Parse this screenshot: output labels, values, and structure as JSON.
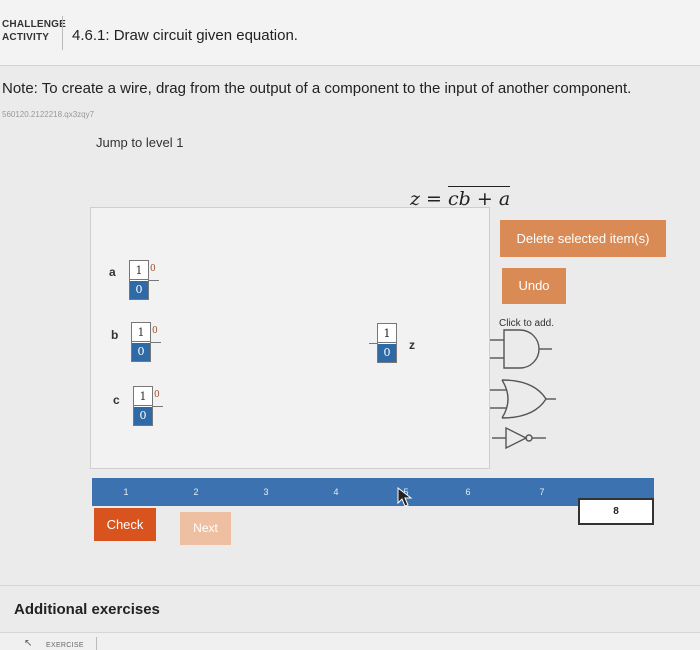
{
  "header": {
    "challenge_line1": "CHALLENGE",
    "challenge_line2": "ACTIVITY",
    "title": "4.6.1: Draw circuit given equation."
  },
  "note": "Note: To create a wire, drag from the output of a component to the input of another component.",
  "code": "560120.2122218.qx3zqy7",
  "jump_label": "Jump to level 1",
  "equation": {
    "lhs": "z = ",
    "expr": "cb + a"
  },
  "inputs": [
    {
      "label": "a",
      "top": "1",
      "bottom": "0",
      "out": "0"
    },
    {
      "label": "b",
      "top": "1",
      "bottom": "0",
      "out": "0"
    },
    {
      "label": "c",
      "top": "1",
      "bottom": "0",
      "out": "0"
    }
  ],
  "output": {
    "label": "z",
    "top": "1",
    "bottom": "0"
  },
  "buttons": {
    "delete": "Delete selected item(s)",
    "undo": "Undo",
    "check": "Check",
    "next": "Next"
  },
  "click_to_add": "Click to add.",
  "gate_icons": [
    "and-gate-icon",
    "or-gate-icon",
    "not-gate-icon"
  ],
  "levels": [
    "1",
    "2",
    "3",
    "4",
    "5",
    "6",
    "7",
    "8"
  ],
  "current_level": "8",
  "additional_exercises": "Additional exercises",
  "exercise_tab": "EXERCISE",
  "colors": {
    "accent": "#d98a55",
    "check": "#d9531e",
    "next": "#efbfa1",
    "level_bar": "#3d72b0",
    "switch_bit": "#2d6aa6"
  }
}
